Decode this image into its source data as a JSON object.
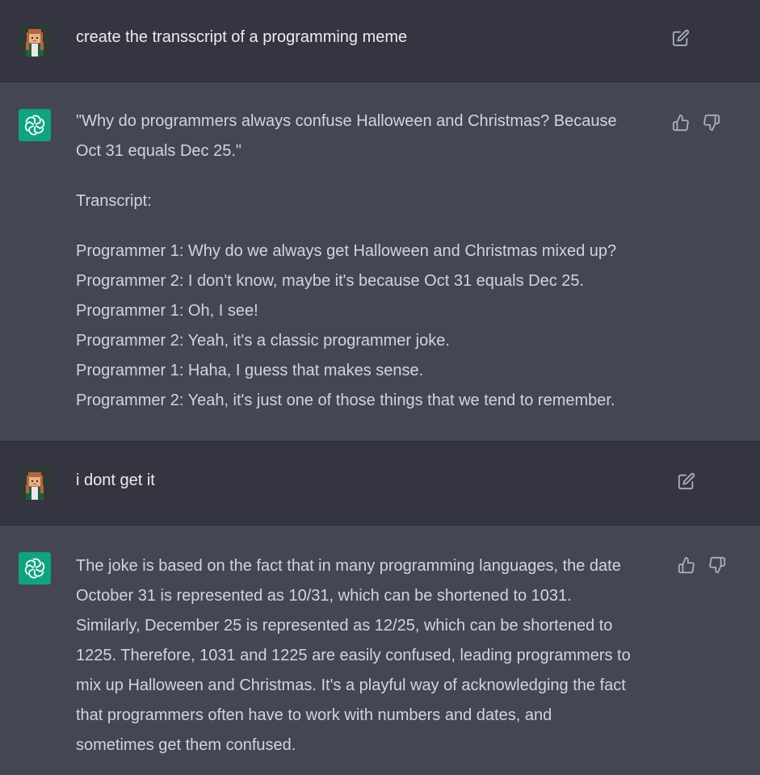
{
  "messages": [
    {
      "role": "user",
      "text": "create the transscript of a programming meme"
    },
    {
      "role": "assistant",
      "paragraphs": [
        [
          "\"Why do programmers always confuse Halloween and Christmas? Because",
          "Oct 31 equals Dec 25.\""
        ],
        [
          "Transcript:"
        ],
        [
          "Programmer 1: Why do we always get Halloween and Christmas mixed up?",
          "Programmer 2: I don't know, maybe it's because Oct 31 equals Dec 25.",
          "Programmer 1: Oh, I see!",
          "Programmer 2: Yeah, it's a classic programmer joke.",
          "Programmer 1: Haha, I guess that makes sense.",
          "Programmer 2: Yeah, it's just one of those things that we tend to remember."
        ]
      ]
    },
    {
      "role": "user",
      "text": "i dont get it"
    },
    {
      "role": "assistant",
      "paragraphs": [
        [
          "The joke is based on the fact that in many programming languages, the date",
          "October 31 is represented as 10/31, which can be shortened to 1031.",
          "Similarly, December 25 is represented as 12/25, which can be shortened to",
          "1225. Therefore, 1031 and 1225 are easily confused, leading programmers to",
          "mix up Halloween and Christmas. It's a playful way of acknowledging the fact",
          "that programmers often have to work with numbers and dates, and",
          "sometimes get them confused."
        ]
      ]
    }
  ],
  "colors": {
    "user_bg": "#343541",
    "assistant_bg": "#444654",
    "gpt_avatar": "#10a37f",
    "text": "#d1d5db"
  },
  "icons": {
    "edit": "edit-icon",
    "thumbs_up": "thumbs-up-icon",
    "thumbs_down": "thumbs-down-icon",
    "assistant_logo": "openai-logo-icon"
  }
}
